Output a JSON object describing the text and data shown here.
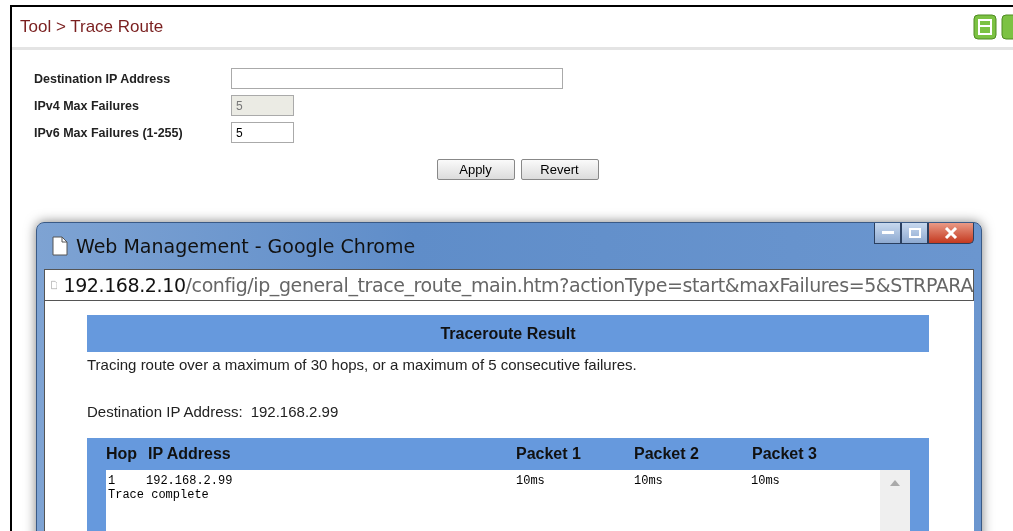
{
  "breadcrumb": "Tool > Trace Route",
  "form": [
    {
      "label": "Destination IP Address",
      "wide": true,
      "disabled": false
    },
    {
      "label": "IPv4 Max Failures",
      "value": "5",
      "wide": false,
      "disabled": true
    },
    {
      "label": "IPv6 Max Failures (1-255)",
      "value": "5",
      "wide": false,
      "disabled": false
    }
  ],
  "buttons": [
    "Apply",
    "Revert"
  ],
  "popup": {
    "title": "Web Management - Google Chrome",
    "url_host": "192.168.2.10",
    "url_path": "/config/ip_general_trace_route_main.htm?actionType=start&maxFailures=5&STRPARA",
    "result_title": "Traceroute Result",
    "summary": "Tracing route over a maximum of 30 hops, or a maximum of 5 consecutive failures.",
    "destination_label": "Destination IP Address:",
    "destination_value": "192.168.2.99",
    "columns": [
      "Hop",
      "IP Address",
      "Packet 1",
      "Packet 2",
      "Packet 3"
    ],
    "rows": [
      [
        "1",
        "192.168.2.99",
        "10ms",
        "10ms",
        "10ms"
      ]
    ],
    "footer_line": "Trace complete"
  }
}
